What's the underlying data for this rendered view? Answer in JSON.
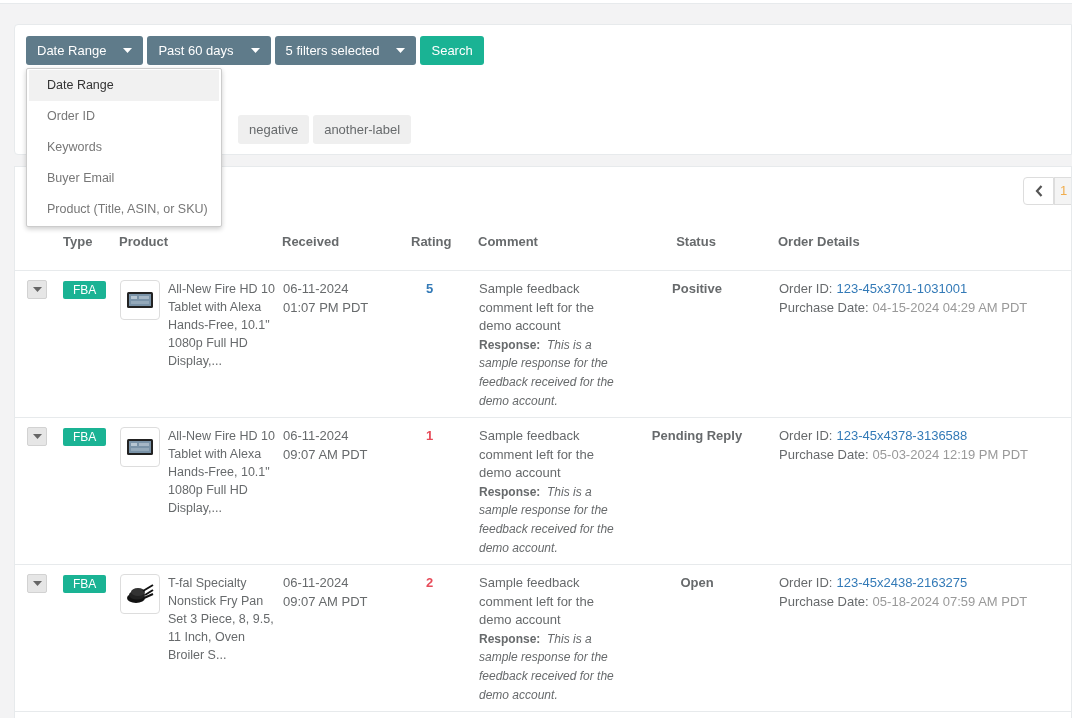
{
  "filters": {
    "buttons": [
      {
        "label": "Date Range",
        "kind": "dropdown"
      },
      {
        "label": "Past 60 days",
        "kind": "dropdown"
      },
      {
        "label": "5 filters selected",
        "kind": "dropdown"
      },
      {
        "label": "Search",
        "kind": "submit"
      }
    ],
    "menu": [
      {
        "label": "Date Range",
        "selected": true
      },
      {
        "label": "Order ID",
        "selected": false
      },
      {
        "label": "Keywords",
        "selected": false
      },
      {
        "label": "Buyer Email",
        "selected": false
      },
      {
        "label": "Product (Title, ASIN, or SKU)",
        "selected": false
      }
    ],
    "labels": [
      "negative",
      "another-label"
    ]
  },
  "pagination": {
    "current": "1"
  },
  "table": {
    "columns": [
      "Type",
      "Product",
      "Received",
      "Rating",
      "Comment",
      "Status",
      "Order Details"
    ],
    "rows": [
      {
        "type": "FBA",
        "kind": "tablet",
        "product": "All-New Fire HD 10 Tablet with Alexa Hands-Free, 10.1\" 1080p Full HD Display,...",
        "date": "06-11-2024",
        "time": "01:07 PM PDT",
        "rating": "5",
        "color": "#337ab7",
        "comment": "Sample feedback comment left for the demo account",
        "response": "**Response:**  *This is a sample response for the feedback received for the demo account.*",
        "status": "Positive",
        "order_label": "Order ID:",
        "order_id": "123-45x3701-1031001",
        "purchase_label": "Purchase Date:",
        "purchase_date": "04-15-2024 04:29 AM PDT"
      },
      {
        "type": "FBA",
        "kind": "tablet",
        "product": "All-New Fire HD 10 Tablet with Alexa Hands-Free, 10.1\" 1080p Full HD Display,...",
        "date": "06-11-2024",
        "time": "09:07 AM PDT",
        "rating": "1",
        "color": "#e74c5a",
        "comment": "Sample feedback comment left for the demo account",
        "response": "**Response:**  *This is a sample response for the feedback received for the demo account.*",
        "status": "Pending Reply",
        "order_label": "Order ID:",
        "order_id": "123-45x4378-3136588",
        "purchase_label": "Purchase Date:",
        "purchase_date": "05-03-2024 12:19 PM PDT"
      },
      {
        "type": "FBA",
        "kind": "pan",
        "product": "T-fal Specialty Nonstick Fry Pan Set 3 Piece, 8, 9.5, 11 Inch, Oven Broiler S...",
        "date": "06-11-2024",
        "time": "09:07 AM PDT",
        "rating": "2",
        "color": "#e74c5a",
        "comment": "Sample feedback comment left for the demo account",
        "response": "**Response:**  *This is a sample response for the feedback received for the demo account.*",
        "status": "Open",
        "order_label": "Order ID:",
        "order_id": "123-45x2438-2163275",
        "purchase_label": "Purchase Date:",
        "purchase_date": "05-18-2024 07:59 AM PDT"
      }
    ]
  }
}
